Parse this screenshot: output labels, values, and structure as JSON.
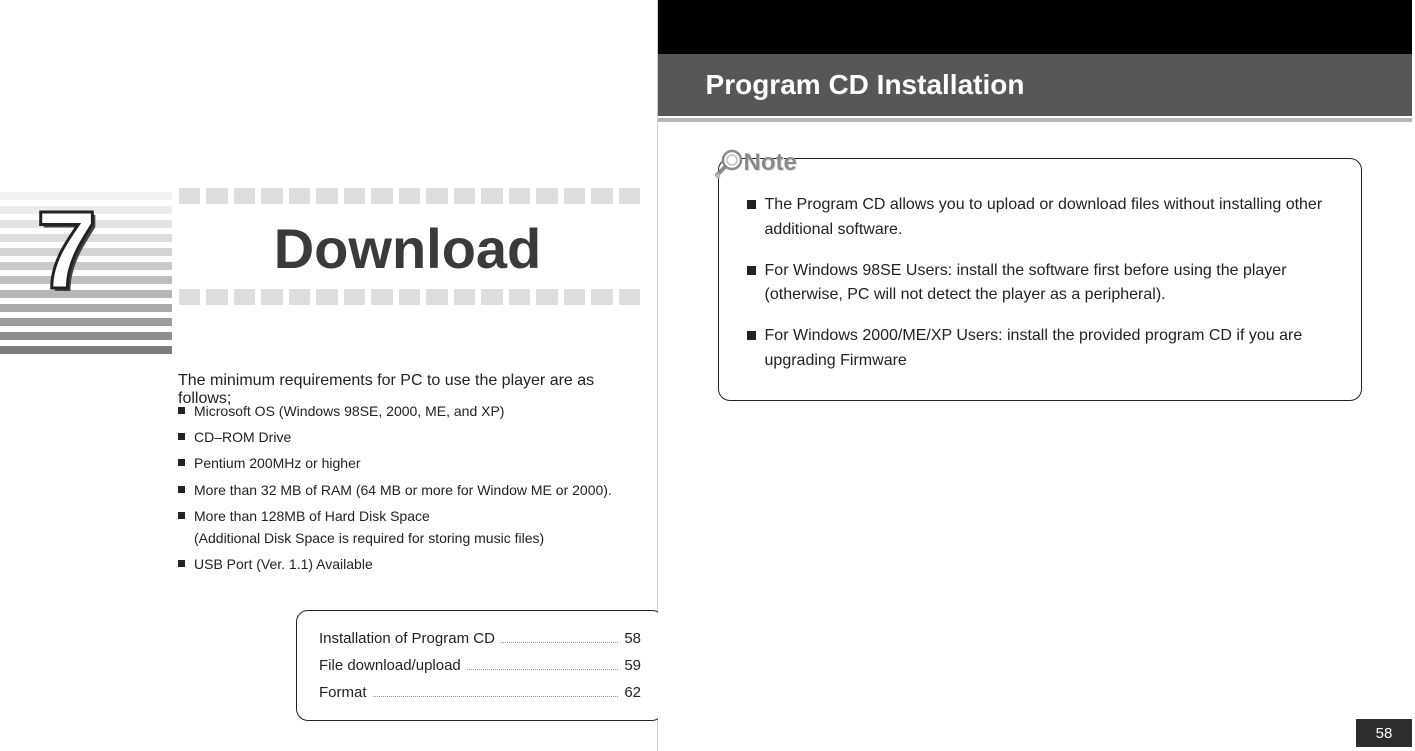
{
  "left": {
    "chapter_number": "7",
    "title": "Download",
    "intro": "The minimum requirements for PC to use the player are as follows;",
    "requirements": [
      {
        "text": "Microsoft OS (Windows 98SE, 2000, ME, and XP)"
      },
      {
        "text": "CD–ROM Drive"
      },
      {
        "text": "Pentium 200MHz or higher"
      },
      {
        "text": "More than 32 MB of RAM (64 MB or more for Window ME or 2000)."
      },
      {
        "text": "More than 128MB of Hard Disk Space",
        "sub": "(Additional Disk Space is required for storing music files)"
      },
      {
        "text": "USB Port (Ver. 1.1) Available"
      }
    ],
    "toc": [
      {
        "label": "Installation of Program CD",
        "page": "58"
      },
      {
        "label": "File download/upload",
        "page": "59"
      },
      {
        "label": "Format",
        "page": "62"
      }
    ]
  },
  "right": {
    "header_title": "Program CD Installation",
    "note_label": "Note",
    "notes": [
      "The Program CD allows you to upload or download files without installing other additional software.",
      "For Windows 98SE Users: install the software first before using the player (otherwise, PC will not detect the player as a peripheral).",
      "For Windows 2000/ME/XP Users: install the provided program CD if you are upgrading Firmware"
    ],
    "page_number": "58"
  },
  "colors": {
    "line_grades": [
      "#f3f3f3",
      "#ececec",
      "#e4e4e4",
      "#dcdcdc",
      "#d3d3d3",
      "#cacaca",
      "#c0c0c0",
      "#b6b6b6",
      "#aaaaaa",
      "#9d9d9d",
      "#8e8e8e",
      "#7d7d7d"
    ]
  }
}
